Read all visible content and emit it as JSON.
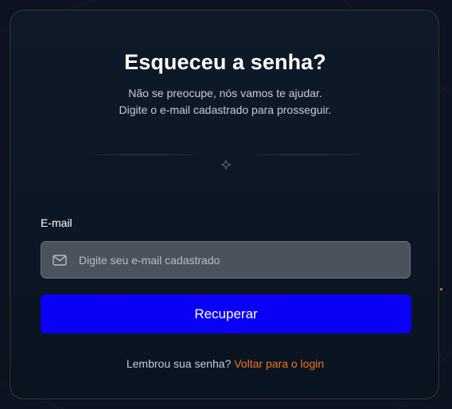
{
  "page": {
    "title": "Esqueceu a senha?",
    "subtitle_line1": "Não se preocupe, nós vamos te ajudar.",
    "subtitle_line2": "Digite o e-mail cadastrado para prosseguir."
  },
  "divider": {
    "icon": "sparkle-icon"
  },
  "form": {
    "email_label": "E-mail",
    "email_placeholder": "Digite seu e-mail cadastrado",
    "email_value": "",
    "email_icon": "mail-icon",
    "submit_label": "Recuperar"
  },
  "footer": {
    "prompt_text": "Lembrou sua senha?",
    "link_text": "Voltar para o login"
  },
  "colors": {
    "background": "#0b1420",
    "card_border": "#3a3a3a",
    "button": "#0a00f5",
    "accent_link": "#f0761c",
    "input_background": "#4a525e"
  }
}
